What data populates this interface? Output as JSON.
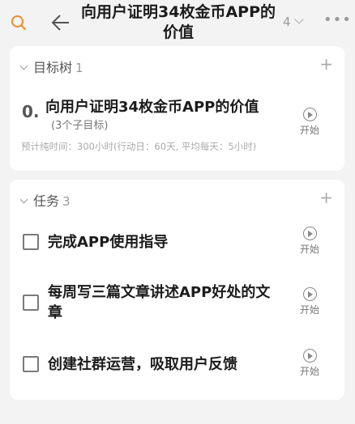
{
  "header": {
    "title": "向用户证明34枚金币APP的价值",
    "count": "4",
    "more": "•••"
  },
  "goals": {
    "section_label": "目标树",
    "count": "1",
    "add": "+",
    "item": {
      "number": "0.",
      "title": "向用户证明34枚金币APP的价值",
      "subtitle": "(3个子目标)",
      "estimate": "预计纯时间：300小时(行动日：60天, 平均每天：5小时)",
      "start_label": "开始"
    }
  },
  "tasks": {
    "section_label": "任务",
    "count": "3",
    "add": "+",
    "items": [
      {
        "label": "完成APP使用指导",
        "start_label": "开始"
      },
      {
        "label": "每周写三篇文章讲述APP好处的文章",
        "start_label": "开始"
      },
      {
        "label": "创建社群运营，吸取用户反馈",
        "start_label": "开始"
      }
    ]
  },
  "icons": {
    "search": "search-icon",
    "back": "arrow-left-icon",
    "play": "play-circle-icon",
    "checkbox": "checkbox-icon",
    "accent": "#f08a2c"
  }
}
